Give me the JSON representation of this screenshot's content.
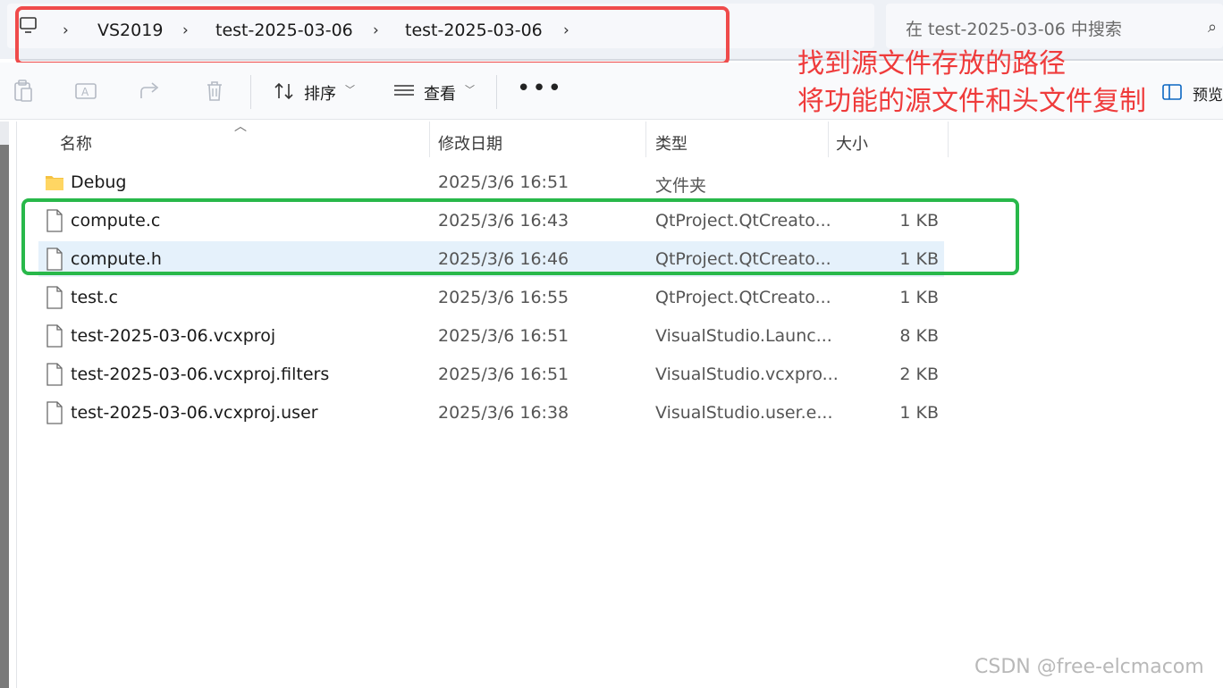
{
  "breadcrumb": {
    "items": [
      "VS2019",
      "test-2025-03-06",
      "test-2025-03-06"
    ]
  },
  "search": {
    "placeholder": "在 test-2025-03-06 中搜索"
  },
  "toolbar": {
    "sort_label": "排序",
    "view_label": "查看",
    "more_label": "•••",
    "preview_label": "预览"
  },
  "annotations": {
    "line1": "找到源文件存放的路径",
    "line2": "将功能的源文件和头文件复制"
  },
  "columns": {
    "name": "名称",
    "modified": "修改日期",
    "type": "类型",
    "size": "大小"
  },
  "files": [
    {
      "name": "Debug",
      "modified": "2025/3/6 16:51",
      "type": "文件夹",
      "size": "",
      "icon": "folder-icon"
    },
    {
      "name": "compute.c",
      "modified": "2025/3/6 16:43",
      "type": "QtProject.QtCreato...",
      "size": "1 KB",
      "icon": "file-icon"
    },
    {
      "name": "compute.h",
      "modified": "2025/3/6 16:46",
      "type": "QtProject.QtCreato...",
      "size": "1 KB",
      "icon": "file-icon",
      "selected": true
    },
    {
      "name": "test.c",
      "modified": "2025/3/6 16:55",
      "type": "QtProject.QtCreato...",
      "size": "1 KB",
      "icon": "file-icon"
    },
    {
      "name": "test-2025-03-06.vcxproj",
      "modified": "2025/3/6 16:51",
      "type": "VisualStudio.Launc...",
      "size": "8 KB",
      "icon": "file-icon"
    },
    {
      "name": "test-2025-03-06.vcxproj.filters",
      "modified": "2025/3/6 16:51",
      "type": "VisualStudio.vcxpro...",
      "size": "2 KB",
      "icon": "file-icon"
    },
    {
      "name": "test-2025-03-06.vcxproj.user",
      "modified": "2025/3/6 16:38",
      "type": "VisualStudio.user.e...",
      "size": "1 KB",
      "icon": "file-icon"
    }
  ],
  "watermark": "CSDN @free-elcmacom",
  "colors": {
    "annotation_red": "#ef3b3b",
    "highlight_green": "#28b84a",
    "selection": "#e5f1fb"
  }
}
